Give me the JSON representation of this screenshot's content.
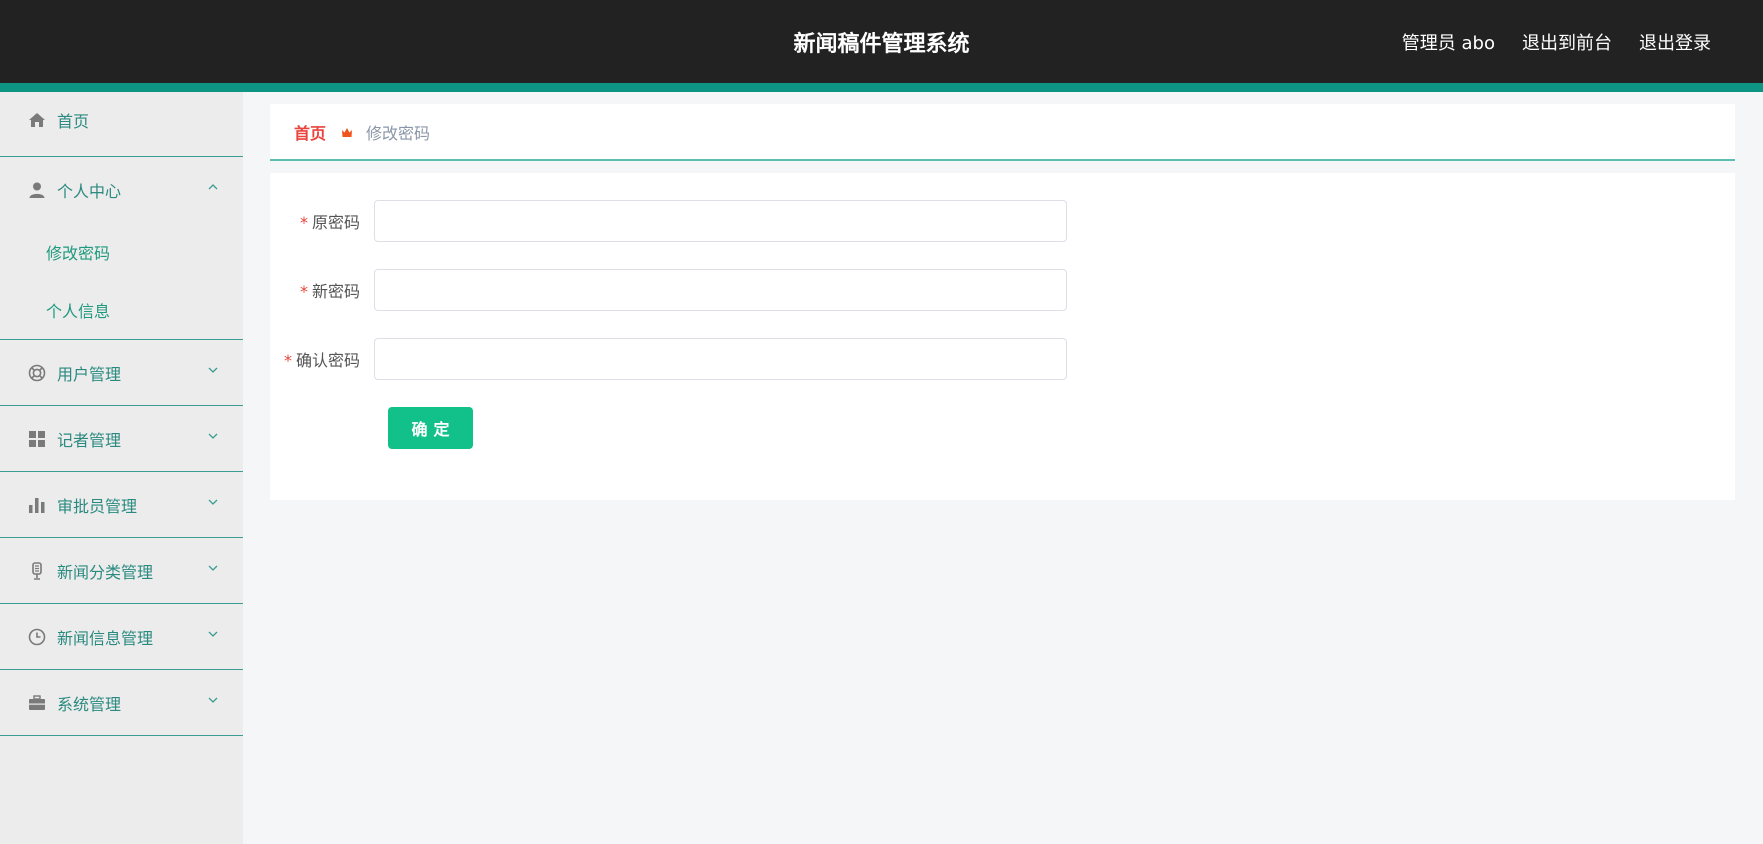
{
  "header": {
    "title": "新闻稿件管理系统",
    "user_label": "管理员 abo",
    "front_link": "退出到前台",
    "logout_link": "退出登录",
    "accent_color": "#0e9483"
  },
  "sidebar": {
    "home": "首页",
    "personal_center": {
      "label": "个人中心",
      "children": [
        "修改密码",
        "个人信息"
      ]
    },
    "items": [
      {
        "label": "用户管理",
        "icon": "lifebuoy-icon"
      },
      {
        "label": "记者管理",
        "icon": "grid-icon"
      },
      {
        "label": "审批员管理",
        "icon": "bar-chart-icon"
      },
      {
        "label": "新闻分类管理",
        "icon": "microphone-icon"
      },
      {
        "label": "新闻信息管理",
        "icon": "clock-icon"
      },
      {
        "label": "系统管理",
        "icon": "briefcase-icon"
      }
    ]
  },
  "breadcrumb": {
    "home": "首页",
    "current": "修改密码"
  },
  "form": {
    "required_mark": "*",
    "fields": [
      {
        "label": "原密码",
        "value": "",
        "placeholder": ""
      },
      {
        "label": "新密码",
        "value": "",
        "placeholder": ""
      },
      {
        "label": "确认密码",
        "value": "",
        "placeholder": ""
      }
    ],
    "submit_label": "确定"
  }
}
